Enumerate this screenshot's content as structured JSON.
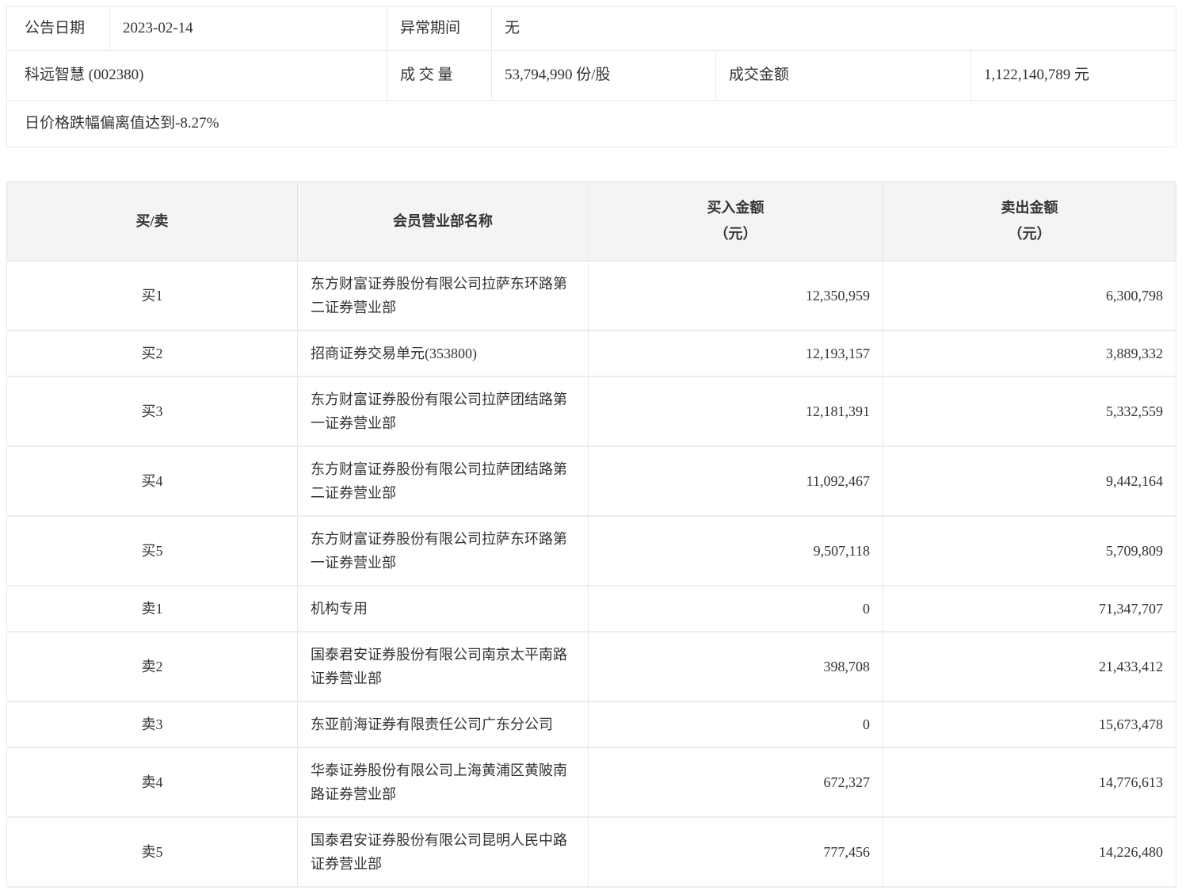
{
  "summary": {
    "announce_date_label": "公告日期",
    "announce_date": "2023-02-14",
    "abnormal_period_label": "异常期间",
    "abnormal_period": "无",
    "stock": "科远智慧 (002380)",
    "volume_label": "成 交 量",
    "volume": "53,794,990 份/股",
    "turnover_label": "成交金额",
    "turnover": "1,122,140,789 元",
    "reason": "日价格跌幅偏离值达到-8.27%"
  },
  "table": {
    "headers": {
      "side": "买/卖",
      "branch": "会员营业部名称",
      "buy": "买入金额",
      "sell": "卖出金额",
      "unit": "（元）"
    },
    "rows": [
      {
        "side": "买1",
        "branch": "东方财富证券股份有限公司拉萨东环路第二证券营业部",
        "buy": "12,350,959",
        "sell": "6,300,798"
      },
      {
        "side": "买2",
        "branch": "招商证券交易单元(353800)",
        "buy": "12,193,157",
        "sell": "3,889,332"
      },
      {
        "side": "买3",
        "branch": "东方财富证券股份有限公司拉萨团结路第一证券营业部",
        "buy": "12,181,391",
        "sell": "5,332,559"
      },
      {
        "side": "买4",
        "branch": "东方财富证券股份有限公司拉萨团结路第二证券营业部",
        "buy": "11,092,467",
        "sell": "9,442,164"
      },
      {
        "side": "买5",
        "branch": "东方财富证券股份有限公司拉萨东环路第一证券营业部",
        "buy": "9,507,118",
        "sell": "5,709,809"
      },
      {
        "side": "卖1",
        "branch": "机构专用",
        "buy": "0",
        "sell": "71,347,707"
      },
      {
        "side": "卖2",
        "branch": "国泰君安证券股份有限公司南京太平南路证券营业部",
        "buy": "398,708",
        "sell": "21,433,412"
      },
      {
        "side": "卖3",
        "branch": "东亚前海证券有限责任公司广东分公司",
        "buy": "0",
        "sell": "15,673,478"
      },
      {
        "side": "卖4",
        "branch": "华泰证券股份有限公司上海黄浦区黄陂南路证券营业部",
        "buy": "672,327",
        "sell": "14,776,613"
      },
      {
        "side": "卖5",
        "branch": "国泰君安证券股份有限公司昆明人民中路证券营业部",
        "buy": "777,456",
        "sell": "14,226,480"
      }
    ]
  }
}
